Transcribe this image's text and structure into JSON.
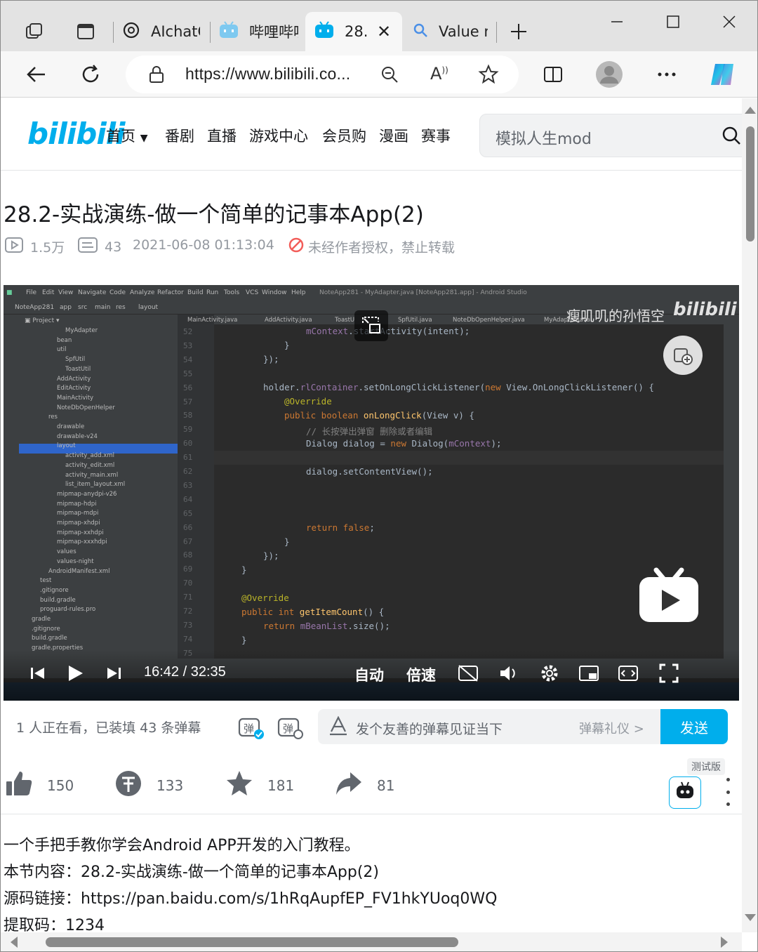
{
  "browser": {
    "tabs": [
      {
        "label": "AIchatO",
        "icon": "openai-icon"
      },
      {
        "label": "哔哩哔哩",
        "icon": "bilibili-tv-icon"
      },
      {
        "label": "28.2",
        "icon": "bilibili-tv-icon",
        "active": true
      },
      {
        "label": "Value m",
        "icon": "search-icon"
      }
    ],
    "url": "https://www.bilibili.co..."
  },
  "site": {
    "logo": "bilibili",
    "nav": [
      "首页",
      "番剧",
      "直播",
      "游戏中心",
      "会员购",
      "漫画",
      "赛事"
    ],
    "search_placeholder": "模拟人生mod"
  },
  "video": {
    "title": "28.2-实战演练-做一个简单的记事本App(2)",
    "views": "1.5万",
    "danmaku": "43",
    "date": "2021-06-08 01:13:04",
    "copyright_note": "未经作者授权，禁止转载"
  },
  "player": {
    "current_time": "16:42",
    "separator": "/",
    "duration": "32:35",
    "auto_label": "自动",
    "speed_label": "倍速",
    "watermark": "瘦叽叽的孙悟空",
    "ide": {
      "menu": [
        "File",
        "Edit",
        "View",
        "Navigate",
        "Code",
        "Analyze",
        "Refactor",
        "Build",
        "Run",
        "Tools",
        "VCS",
        "Window",
        "Help"
      ],
      "window_title": "NoteApp281 - MyAdapter.java [NoteApp281.app] - Android Studio",
      "breadcrumb": [
        "NoteApp281",
        "app",
        "src",
        "main",
        "res",
        "layout"
      ],
      "editor_tabs": [
        "MainActivity.java",
        "AddActivity.java",
        "ToastU",
        "SpfUtil.java",
        "NoteDbOpenHelper.java",
        "MyAdapter.java",
        "EditActivity.java"
      ],
      "tree": [
        {
          "label": "MyAdapter",
          "indent": 4
        },
        {
          "label": "bean",
          "indent": 3
        },
        {
          "label": "util",
          "indent": 3
        },
        {
          "label": "SpfUtil",
          "indent": 4
        },
        {
          "label": "ToastUtil",
          "indent": 4
        },
        {
          "label": "AddActivity",
          "indent": 3
        },
        {
          "label": "EditActivity",
          "indent": 3
        },
        {
          "label": "MainActivity",
          "indent": 3
        },
        {
          "label": "NoteDbOpenHelper",
          "indent": 3
        },
        {
          "label": "res",
          "indent": 2
        },
        {
          "label": "drawable",
          "indent": 3
        },
        {
          "label": "drawable-v24",
          "indent": 3
        },
        {
          "label": "layout",
          "indent": 3
        },
        {
          "label": "activity_add.xml",
          "indent": 4
        },
        {
          "label": "activity_edit.xml",
          "indent": 4
        },
        {
          "label": "activity_main.xml",
          "indent": 4
        },
        {
          "label": "list_item_layout.xml",
          "indent": 4
        },
        {
          "label": "mipmap-anydpi-v26",
          "indent": 3
        },
        {
          "label": "mipmap-hdpi",
          "indent": 3
        },
        {
          "label": "mipmap-mdpi",
          "indent": 3
        },
        {
          "label": "mipmap-xhdpi",
          "indent": 3
        },
        {
          "label": "mipmap-xxhdpi",
          "indent": 3
        },
        {
          "label": "mipmap-xxxhdpi",
          "indent": 3
        },
        {
          "label": "values",
          "indent": 3
        },
        {
          "label": "values-night",
          "indent": 3
        },
        {
          "label": "AndroidManifest.xml",
          "indent": 2
        },
        {
          "label": "test",
          "indent": 1
        },
        {
          "label": ".gitignore",
          "indent": 1
        },
        {
          "label": "build.gradle",
          "indent": 1
        },
        {
          "label": "proguard-rules.pro",
          "indent": 1
        },
        {
          "label": "gradle",
          "indent": 0
        },
        {
          "label": ".gitignore",
          "indent": 0
        },
        {
          "label": "build.gradle",
          "indent": 0
        },
        {
          "label": "gradle.properties",
          "indent": 0
        }
      ],
      "line_numbers": [
        "52",
        "53",
        "54",
        "55",
        "56",
        "57",
        "58",
        "59",
        "60",
        "61",
        "62",
        "63",
        "64",
        "65",
        "66",
        "67",
        "68",
        "69",
        "70",
        "71",
        "72",
        "73",
        "74",
        "75"
      ]
    }
  },
  "danmaku_bar": {
    "viewer_text": "1 人正在看，已装填 43 条弹幕",
    "input_placeholder": "发个友善的弹幕见证当下",
    "gift_label": "弹幕礼仪 >",
    "send_label": "发送"
  },
  "actions": {
    "like": "150",
    "coin": "133",
    "favorite": "181",
    "share": "81",
    "beta_label": "测试版"
  },
  "description": [
    "一个手把手教你学会Android APP开发的入门教程。",
    "本节内容：28.2-实战演练-做一个简单的记事本App(2)",
    "源码链接：https://pan.baidu.com/s/1hRqAupfEP_FV1hkYUoq0WQ",
    "提取码：1234"
  ],
  "colors": {
    "brand": "#00aeec",
    "warn": "#f25d59"
  }
}
